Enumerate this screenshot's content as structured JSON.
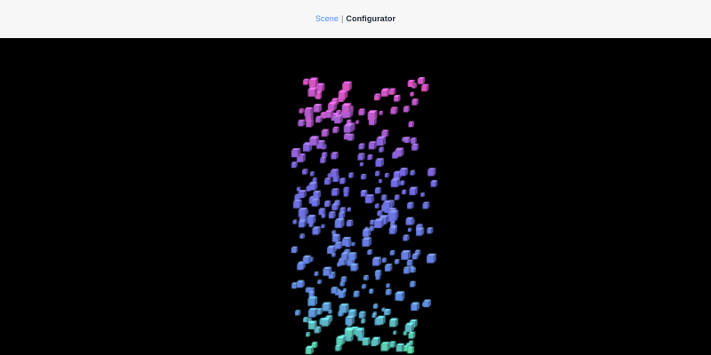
{
  "header": {
    "breadcrumb": {
      "link_label": "Scene",
      "separator": "|",
      "current_label": "Configurator"
    }
  },
  "colors": {
    "header_background": "#f7f7f8",
    "link": "#4d8ff2",
    "viewport_background": "#000000",
    "cube_top": "#ff5bd6",
    "cube_mid": "#7e74ff",
    "cube_low": "#69a0ff",
    "cube_bottom": "#62ffb0"
  }
}
